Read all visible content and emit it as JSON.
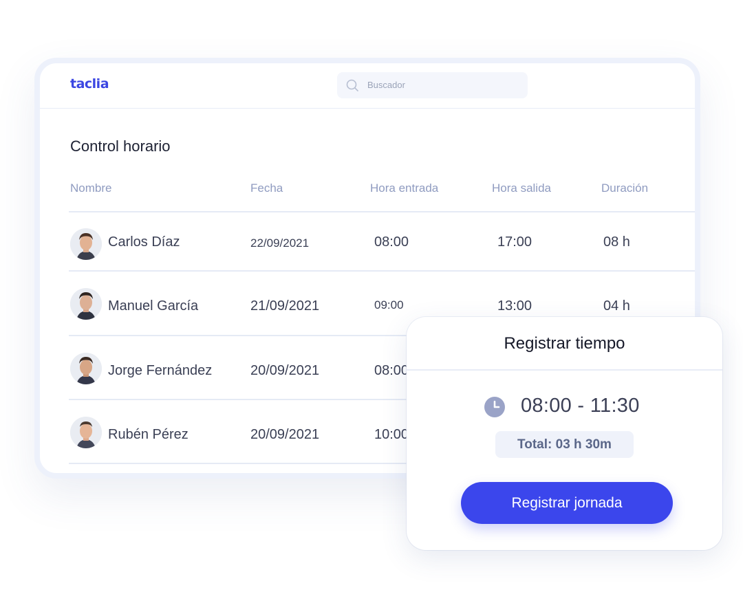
{
  "app": {
    "logo": "taclia",
    "search": {
      "placeholder": "Buscador"
    }
  },
  "page": {
    "title": "Control horario",
    "columns": [
      "Nombre",
      "Fecha",
      "Hora entrada",
      "Hora salida",
      "Duración"
    ]
  },
  "rows": [
    {
      "name": "Carlos Díaz",
      "date": "22/09/2021",
      "entry": "08:00",
      "exit": "17:00",
      "duration": "08 h"
    },
    {
      "name": "Manuel García",
      "date": "21/09/2021",
      "entry": "09:00",
      "exit": "13:00",
      "duration": "04 h"
    },
    {
      "name": "Jorge Fernández",
      "date": "20/09/2021",
      "entry": "08:00",
      "exit": "",
      "duration": ""
    },
    {
      "name": "Rubén Pérez",
      "date": "20/09/2021",
      "entry": "10:00",
      "exit": "",
      "duration": ""
    }
  ],
  "modal": {
    "title": "Registrar tiempo",
    "time_range": "08:00 - 11:30",
    "total": "Total: 03 h 30m",
    "button_label": "Registrar jornada"
  },
  "colors": {
    "brand": "#3b46e2",
    "button": "#3b46ec",
    "header_text": "#8f9bc0",
    "clock_icon": "#9aa3c7"
  },
  "icons": [
    "search-icon",
    "clock-icon",
    "avatar"
  ]
}
